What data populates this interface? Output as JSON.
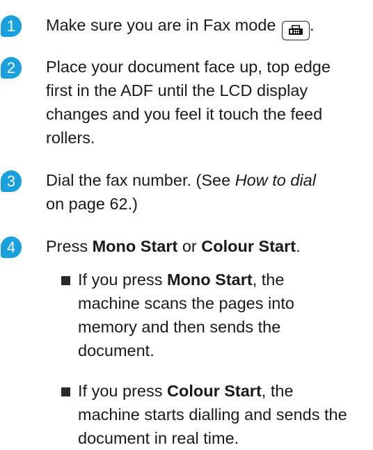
{
  "steps": [
    {
      "number": "1",
      "line1_before": "Make sure you are in Fax mode",
      "line1_after": "."
    },
    {
      "number": "2",
      "lines": [
        "Place your document face up, top edge",
        "first in the ADF until the LCD display",
        "changes and you feel it touch the feed",
        "rollers."
      ]
    },
    {
      "number": "3",
      "line1_prefix": "Dial the fax number. (See ",
      "line1_link": "How to dial",
      "line2": "on page 62.)"
    },
    {
      "number": "4",
      "press": "Press ",
      "mono_start": "Mono Start",
      "or": " or ",
      "colour_start": "Colour Start",
      "period": ".",
      "bullets": [
        {
          "lead": "If you press ",
          "button": "Mono Start",
          "after": ", the",
          "lines": [
            "machine scans the pages into",
            "memory and then sends the",
            "document."
          ]
        },
        {
          "lead": "If you press ",
          "button": "Colour Start",
          "after": ", the",
          "lines": [
            "machine starts dialling and sends the",
            "document in real time."
          ]
        }
      ]
    }
  ],
  "icons": {
    "fax_mode": "fax-icon"
  },
  "colors": {
    "badge": "#1aa0dc"
  }
}
